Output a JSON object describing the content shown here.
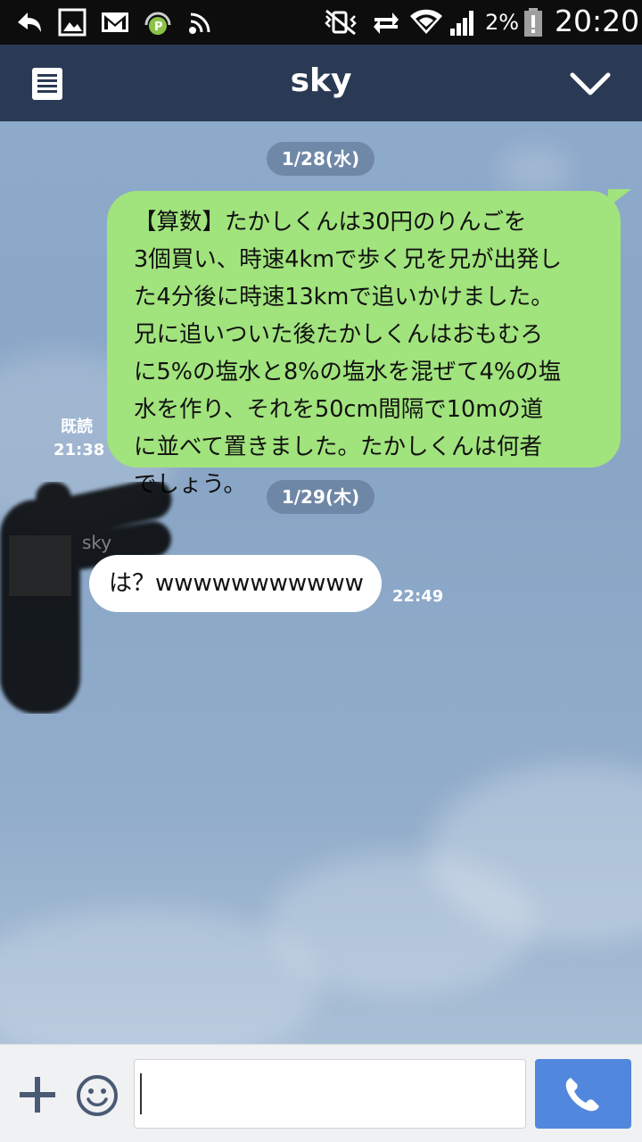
{
  "status_bar": {
    "left_icons": [
      "back-arrow-icon",
      "gallery-icon",
      "gmail-icon",
      "podcast-app-icon",
      "cast-icon"
    ],
    "right_icons": [
      "mute-vibrate-icon",
      "data-transfer-icon",
      "wifi-icon",
      "signal-icon",
      "battery-icon"
    ],
    "battery_percent": "2%",
    "time": "20:20"
  },
  "header": {
    "title": "sky",
    "menu_icon": "notes-list-icon",
    "dropdown_icon": "chevron-down-icon"
  },
  "chat": {
    "messages": [
      {
        "date": "1/28(水)",
        "direction": "sent",
        "lines": [
          "【算数】たかしくんは30円のりんごを",
          "3個買い、時速4kmで歩く兄を兄が出発し",
          "た4分後に時速13kmで追いかけました。",
          "兄に追いついた後たかしくんはおもむろ",
          "に5%の塩水と8%の塩水を混ぜて4%の塩",
          "水を作り、それを50cm間隔で10mの道",
          "に並べて置きました。たかしくんは何者",
          "でしょう。"
        ],
        "read_label": "既読",
        "time": "21:38"
      },
      {
        "date": "1/29(木)",
        "direction": "received",
        "sender": "sky",
        "text": "は？wwwwwwwwwww",
        "time": "22:49"
      }
    ]
  },
  "input_bar": {
    "plus_icon": "plus-icon",
    "emoji_icon": "smiley-icon",
    "placeholder": "",
    "value": "",
    "call_icon": "phone-icon"
  },
  "colors": {
    "header_bg": "#2a3a54",
    "sent_bubble": "#a1e37d",
    "received_bubble": "#ffffff",
    "call_button": "#5287de"
  }
}
